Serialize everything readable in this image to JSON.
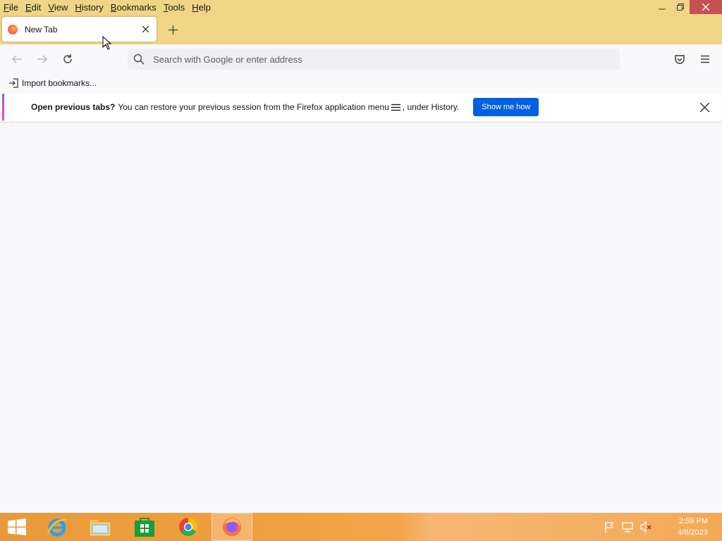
{
  "menubar": {
    "items": [
      {
        "label": "File",
        "key": "F",
        "rest": "ile"
      },
      {
        "label": "Edit",
        "key": "E",
        "rest": "dit"
      },
      {
        "label": "View",
        "key": "V",
        "rest": "iew"
      },
      {
        "label": "History",
        "key": "H",
        "rest": "istory"
      },
      {
        "label": "Bookmarks",
        "key": "B",
        "rest": "ookmarks"
      },
      {
        "label": "Tools",
        "key": "T",
        "rest": "ools"
      },
      {
        "label": "Help",
        "key": "H",
        "rest": "elp"
      }
    ]
  },
  "tab": {
    "title": "New Tab"
  },
  "urlbar": {
    "placeholder": "Search with Google or enter address"
  },
  "bookmarks": {
    "import_label": "Import bookmarks..."
  },
  "notification": {
    "strong": "Open previous tabs?",
    "message": "You can restore your previous session from the Firefox application menu",
    "message_end": ", under History.",
    "button": "Show me how"
  },
  "taskbar": {
    "apps": [
      "windows-start",
      "internet-explorer",
      "file-explorer",
      "store",
      "chrome",
      "firefox"
    ],
    "time": "2:59 PM",
    "date": "4/8/2023"
  },
  "colors": {
    "titlebar": "#f0d586",
    "accent_button": "#0061e0",
    "close_button": "#c75050",
    "taskbar": "#f0a040"
  }
}
